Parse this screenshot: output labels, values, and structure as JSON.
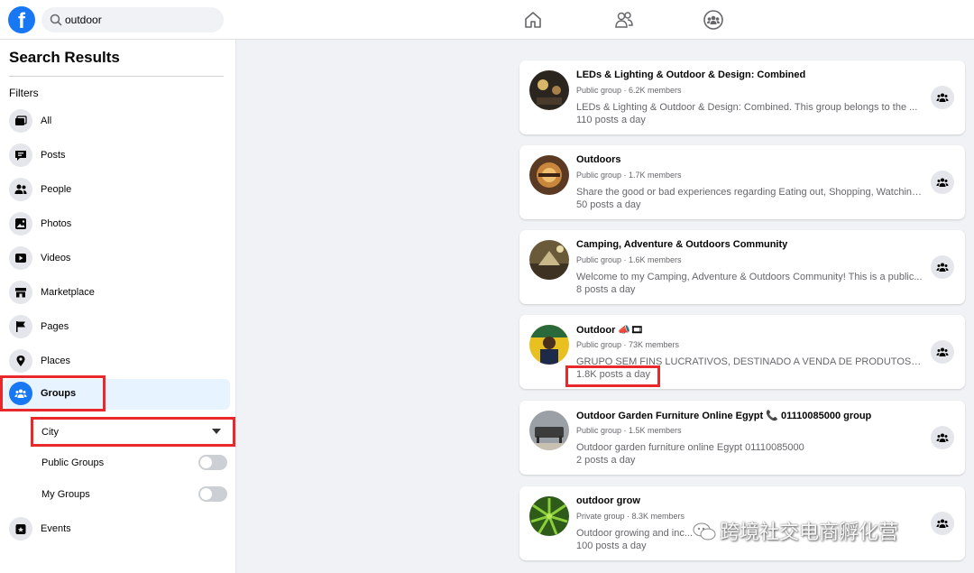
{
  "header": {
    "logo_letter": "f",
    "search": {
      "value": "outdoor"
    }
  },
  "sidebar": {
    "title": "Search Results",
    "filters_label": "Filters",
    "items": [
      {
        "label": "All",
        "icon": "all-icon"
      },
      {
        "label": "Posts",
        "icon": "posts-icon"
      },
      {
        "label": "People",
        "icon": "people-icon"
      },
      {
        "label": "Photos",
        "icon": "photos-icon"
      },
      {
        "label": "Videos",
        "icon": "videos-icon"
      },
      {
        "label": "Marketplace",
        "icon": "marketplace-icon"
      },
      {
        "label": "Pages",
        "icon": "pages-icon"
      },
      {
        "label": "Places",
        "icon": "places-icon"
      },
      {
        "label": "Groups",
        "icon": "groups-icon",
        "active": true
      },
      {
        "label": "Events",
        "icon": "events-icon"
      }
    ],
    "groups_subfilters": {
      "city_select": "City",
      "public_groups_label": "Public Groups",
      "public_groups_on": false,
      "my_groups_label": "My Groups",
      "my_groups_on": false
    }
  },
  "results": [
    {
      "title": "LEDs & Lighting & Outdoor & Design: Combined",
      "meta": "Public group · 6.2K members",
      "description": "LEDs & Lighting & Outdoor & Design: Combined. This group belongs to the ...",
      "posts": "110 posts a day"
    },
    {
      "title": "Outdoors",
      "meta": "Public group · 1.7K members",
      "description": "Share the good or bad experiences regarding Eating out, Shopping, Watching...",
      "posts": "50 posts a day"
    },
    {
      "title": "Camping, Adventure & Outdoors Community",
      "meta": "Public group · 1.6K members",
      "description": "Welcome to my Camping, Adventure & Outdoors Community! This is a public...",
      "posts": "8 posts a day"
    },
    {
      "title": "Outdoor 📣🎞",
      "meta": "Public group · 73K members",
      "description": "GRUPO SEM FINS LUCRATIVOS, DESTINADO A VENDA DE PRODUTOS NOVO...",
      "posts": "1.8K posts a day"
    },
    {
      "title": "Outdoor Garden Furniture Online Egypt 📞 01110085000 group",
      "meta": "Public group · 1.5K members",
      "description": "Outdoor garden furniture online Egypt 01110085000",
      "posts": "2 posts a day"
    },
    {
      "title": "outdoor grow",
      "meta": "Private group · 8.3K members",
      "description": "Outdoor growing and inc...",
      "posts": "100 posts a day"
    }
  ],
  "watermark": {
    "text": "跨境社交电商孵化营"
  },
  "colors": {
    "brand": "#1877f2",
    "highlight": "#e8282b",
    "active_bg": "#e7f3ff"
  }
}
